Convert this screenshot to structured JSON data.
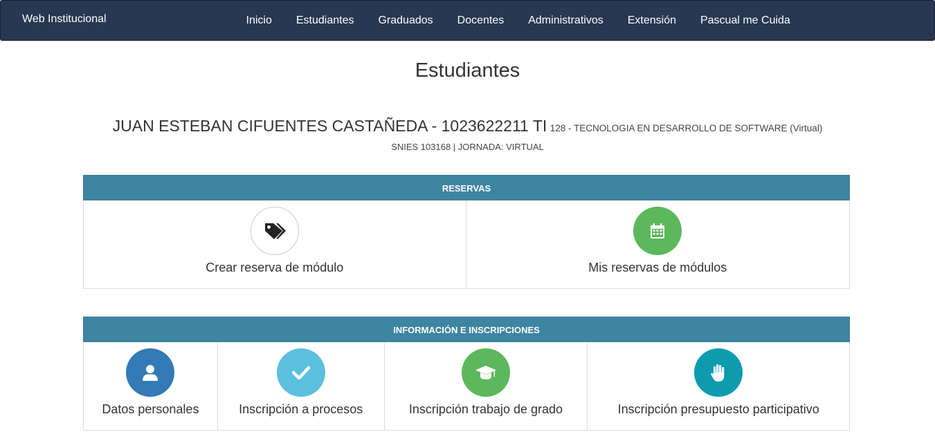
{
  "navbar": {
    "brand": "Web Institucional",
    "items": [
      {
        "label": "Inicio"
      },
      {
        "label": "Estudiantes"
      },
      {
        "label": "Graduados"
      },
      {
        "label": "Docentes"
      },
      {
        "label": "Administrativos"
      },
      {
        "label": "Extensión"
      },
      {
        "label": "Pascual me Cuida"
      }
    ]
  },
  "page": {
    "title": "Estudiantes"
  },
  "student": {
    "name_id": "JUAN ESTEBAN CIFUENTES CASTAÑEDA - 1023622211 TI",
    "program": "128 - TECNOLOGIA EN DESARROLLO DE SOFTWARE (Virtual)",
    "snies": "SNIES 103168 | JORNADA: VIRTUAL"
  },
  "reservas": {
    "header": "RESERVAS",
    "cards": [
      {
        "label": "Crear reserva de módulo",
        "icon": "tags-icon"
      },
      {
        "label": "Mis reservas de módulos",
        "icon": "calendar-icon"
      }
    ]
  },
  "informacion": {
    "header": "INFORMACIÓN E INSCRIPCIONES",
    "cards": [
      {
        "label": "Datos personales",
        "icon": "user-icon"
      },
      {
        "label": "Inscripción a procesos",
        "icon": "check-icon"
      },
      {
        "label": "Inscripción trabajo de grado",
        "icon": "graduation-cap-icon"
      },
      {
        "label": "Inscripción presupuesto participativo",
        "icon": "hand-icon"
      }
    ]
  },
  "colors": {
    "navbar": "#283852",
    "section_header": "#3e85a2",
    "green": "#5cb85c",
    "blue": "#337ab7",
    "light_blue": "#5bc0de",
    "teal": "#0e9bb0"
  }
}
